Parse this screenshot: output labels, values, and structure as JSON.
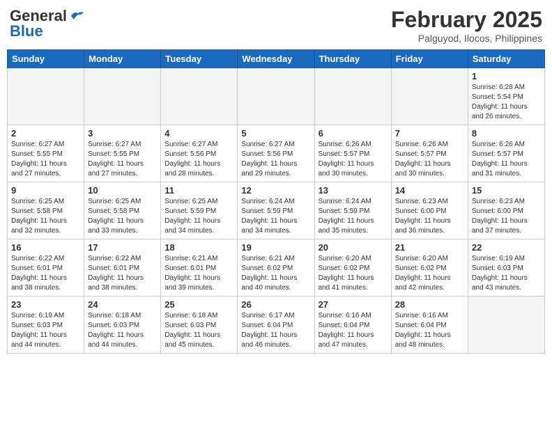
{
  "header": {
    "logo_general": "General",
    "logo_blue": "Blue",
    "month": "February 2025",
    "location": "Palguyod, Ilocos, Philippines"
  },
  "days_of_week": [
    "Sunday",
    "Monday",
    "Tuesday",
    "Wednesday",
    "Thursday",
    "Friday",
    "Saturday"
  ],
  "weeks": [
    [
      {
        "day": "",
        "info": ""
      },
      {
        "day": "",
        "info": ""
      },
      {
        "day": "",
        "info": ""
      },
      {
        "day": "",
        "info": ""
      },
      {
        "day": "",
        "info": ""
      },
      {
        "day": "",
        "info": ""
      },
      {
        "day": "1",
        "info": "Sunrise: 6:28 AM\nSunset: 5:54 PM\nDaylight: 11 hours and 26 minutes."
      }
    ],
    [
      {
        "day": "2",
        "info": "Sunrise: 6:27 AM\nSunset: 5:55 PM\nDaylight: 11 hours and 27 minutes."
      },
      {
        "day": "3",
        "info": "Sunrise: 6:27 AM\nSunset: 5:55 PM\nDaylight: 11 hours and 27 minutes."
      },
      {
        "day": "4",
        "info": "Sunrise: 6:27 AM\nSunset: 5:56 PM\nDaylight: 11 hours and 28 minutes."
      },
      {
        "day": "5",
        "info": "Sunrise: 6:27 AM\nSunset: 5:56 PM\nDaylight: 11 hours and 29 minutes."
      },
      {
        "day": "6",
        "info": "Sunrise: 6:26 AM\nSunset: 5:57 PM\nDaylight: 11 hours and 30 minutes."
      },
      {
        "day": "7",
        "info": "Sunrise: 6:26 AM\nSunset: 5:57 PM\nDaylight: 11 hours and 30 minutes."
      },
      {
        "day": "8",
        "info": "Sunrise: 6:26 AM\nSunset: 5:57 PM\nDaylight: 11 hours and 31 minutes."
      }
    ],
    [
      {
        "day": "9",
        "info": "Sunrise: 6:25 AM\nSunset: 5:58 PM\nDaylight: 11 hours and 32 minutes."
      },
      {
        "day": "10",
        "info": "Sunrise: 6:25 AM\nSunset: 5:58 PM\nDaylight: 11 hours and 33 minutes."
      },
      {
        "day": "11",
        "info": "Sunrise: 6:25 AM\nSunset: 5:59 PM\nDaylight: 11 hours and 34 minutes."
      },
      {
        "day": "12",
        "info": "Sunrise: 6:24 AM\nSunset: 5:59 PM\nDaylight: 11 hours and 34 minutes."
      },
      {
        "day": "13",
        "info": "Sunrise: 6:24 AM\nSunset: 5:59 PM\nDaylight: 11 hours and 35 minutes."
      },
      {
        "day": "14",
        "info": "Sunrise: 6:23 AM\nSunset: 6:00 PM\nDaylight: 11 hours and 36 minutes."
      },
      {
        "day": "15",
        "info": "Sunrise: 6:23 AM\nSunset: 6:00 PM\nDaylight: 11 hours and 37 minutes."
      }
    ],
    [
      {
        "day": "16",
        "info": "Sunrise: 6:22 AM\nSunset: 6:01 PM\nDaylight: 11 hours and 38 minutes."
      },
      {
        "day": "17",
        "info": "Sunrise: 6:22 AM\nSunset: 6:01 PM\nDaylight: 11 hours and 38 minutes."
      },
      {
        "day": "18",
        "info": "Sunrise: 6:21 AM\nSunset: 6:01 PM\nDaylight: 11 hours and 39 minutes."
      },
      {
        "day": "19",
        "info": "Sunrise: 6:21 AM\nSunset: 6:02 PM\nDaylight: 11 hours and 40 minutes."
      },
      {
        "day": "20",
        "info": "Sunrise: 6:20 AM\nSunset: 6:02 PM\nDaylight: 11 hours and 41 minutes."
      },
      {
        "day": "21",
        "info": "Sunrise: 6:20 AM\nSunset: 6:02 PM\nDaylight: 11 hours and 42 minutes."
      },
      {
        "day": "22",
        "info": "Sunrise: 6:19 AM\nSunset: 6:03 PM\nDaylight: 11 hours and 43 minutes."
      }
    ],
    [
      {
        "day": "23",
        "info": "Sunrise: 6:19 AM\nSunset: 6:03 PM\nDaylight: 11 hours and 44 minutes."
      },
      {
        "day": "24",
        "info": "Sunrise: 6:18 AM\nSunset: 6:03 PM\nDaylight: 11 hours and 44 minutes."
      },
      {
        "day": "25",
        "info": "Sunrise: 6:18 AM\nSunset: 6:03 PM\nDaylight: 11 hours and 45 minutes."
      },
      {
        "day": "26",
        "info": "Sunrise: 6:17 AM\nSunset: 6:04 PM\nDaylight: 11 hours and 46 minutes."
      },
      {
        "day": "27",
        "info": "Sunrise: 6:16 AM\nSunset: 6:04 PM\nDaylight: 11 hours and 47 minutes."
      },
      {
        "day": "28",
        "info": "Sunrise: 6:16 AM\nSunset: 6:04 PM\nDaylight: 11 hours and 48 minutes."
      },
      {
        "day": "",
        "info": ""
      }
    ]
  ]
}
